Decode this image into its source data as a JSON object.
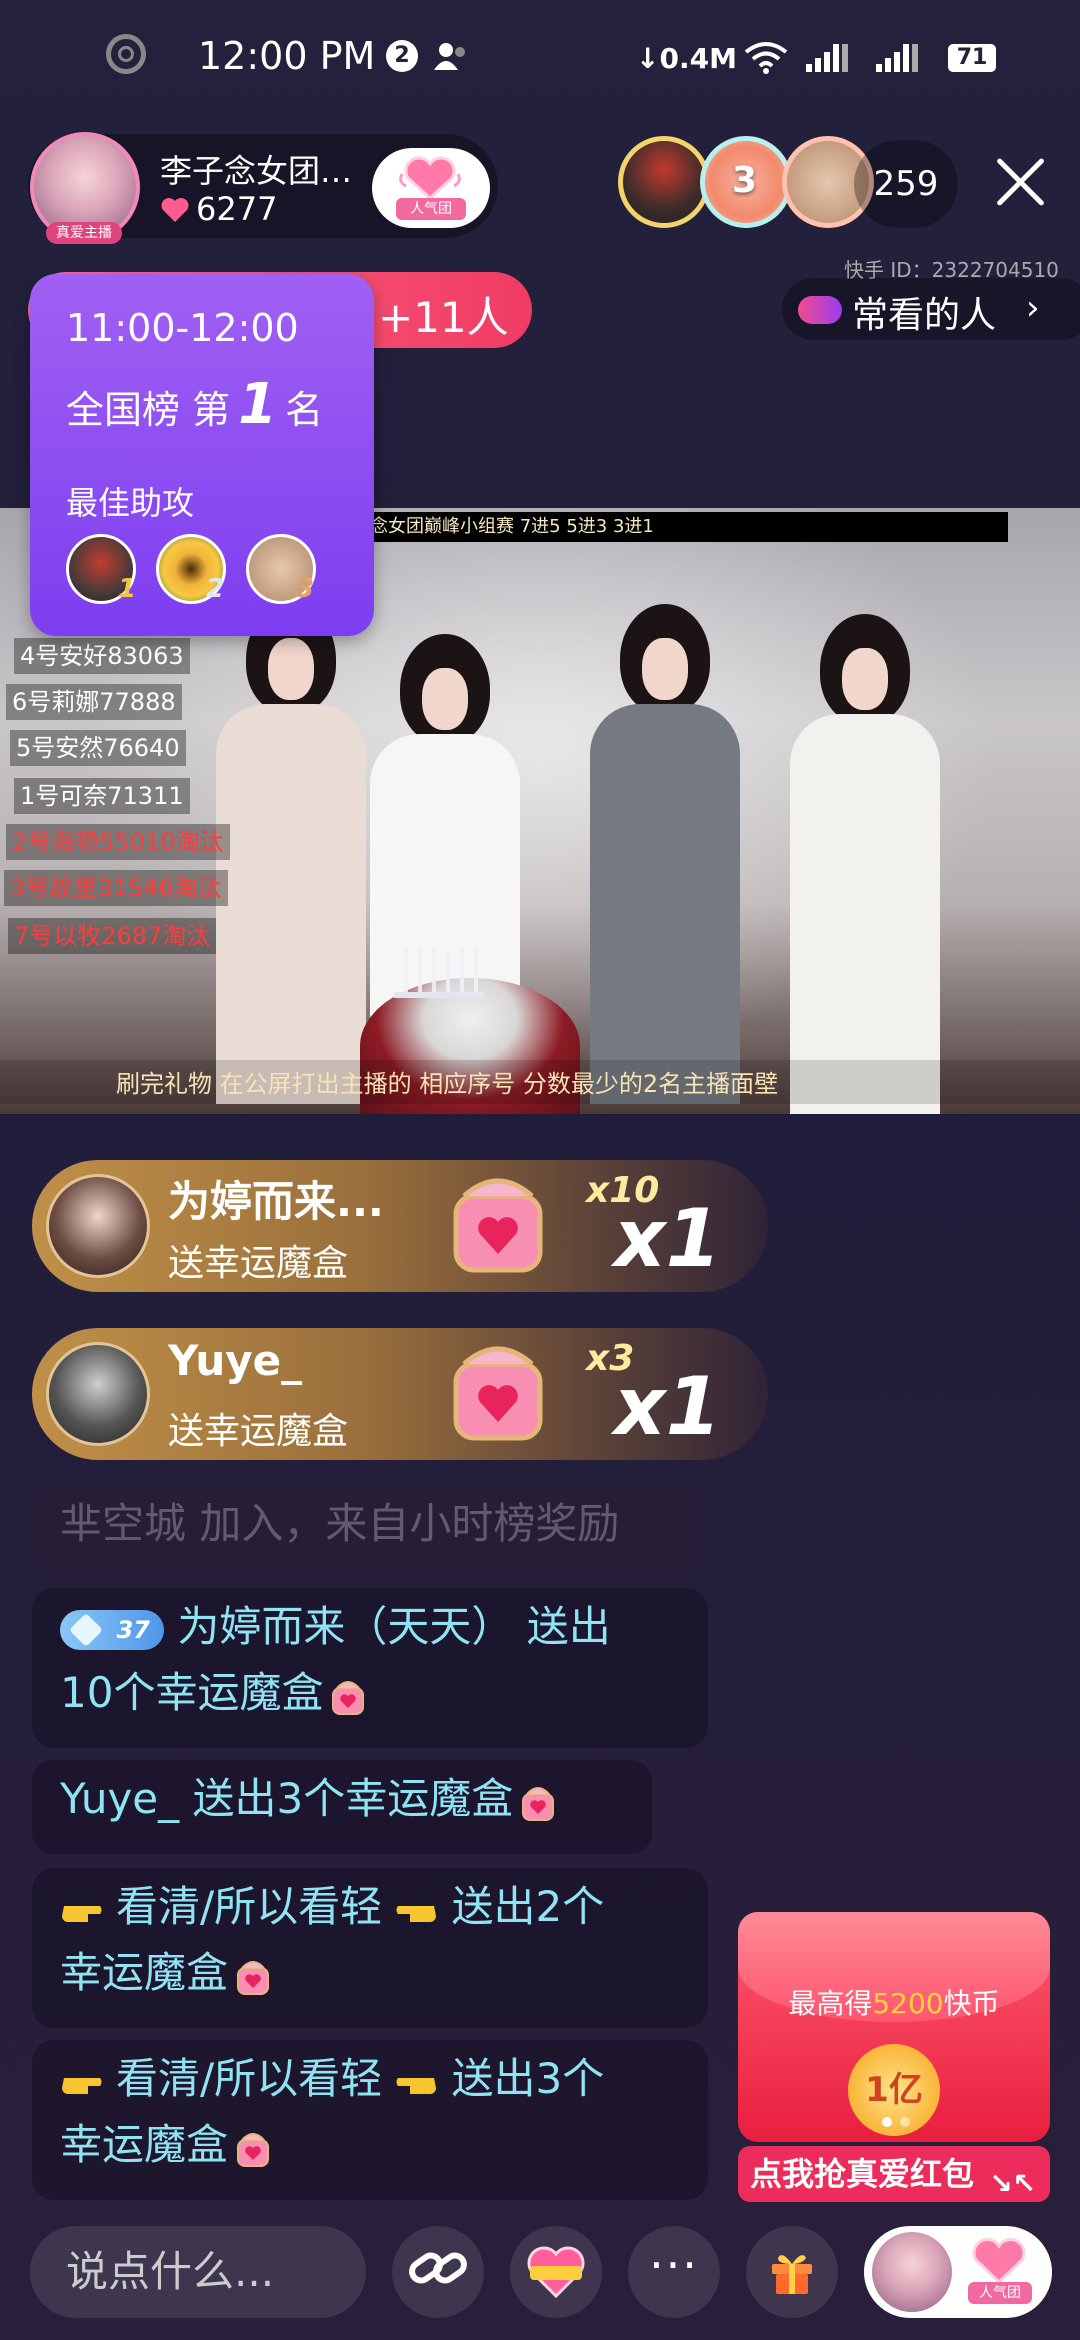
{
  "status_bar": {
    "time": "12:00 PM",
    "notification_count": "2",
    "network_speed": "0.4M",
    "battery": "71"
  },
  "host": {
    "name": "李子念女团…",
    "likes": "6277",
    "badge": "真爱主播",
    "fan_club_label": "人气团"
  },
  "viewers": {
    "count": "259",
    "second_viewer_number": "3",
    "kuaishou_id": "快手 ID：2322704510",
    "often_watched_label": "常看的人"
  },
  "promo_pill": {
    "text": "+11人"
  },
  "rank_card": {
    "time_range": "11:00-12:00",
    "rank_prefix": "全国榜 第",
    "rank_value": "1",
    "rank_suffix": "名",
    "assist_title": "最佳助攻",
    "assist_nums": [
      "1",
      "2",
      "3"
    ]
  },
  "stream": {
    "banner": "念女团巅峰小组赛 7进5 5进3 3进1",
    "scores": [
      {
        "text": "4号安好83063",
        "status": "ok"
      },
      {
        "text": "6号莉娜77888",
        "status": "ok"
      },
      {
        "text": "5号安然76640",
        "status": "ok"
      },
      {
        "text": "1号可奈71311",
        "status": "ok"
      },
      {
        "text": "2号海艳55010淘汰",
        "status": "out"
      },
      {
        "text": "3号故里31546淘汰",
        "status": "out"
      },
      {
        "text": "7号以牧2687淘汰",
        "status": "out"
      }
    ],
    "caption": "刷完礼物 在公屏打出主播的 相应序号 分数最少的2名主播面壁"
  },
  "gift_combos": [
    {
      "user": "为婷而来...",
      "action": "送幸运魔盒",
      "multiplier": "x10",
      "count": "x1"
    },
    {
      "user": "Yuye_",
      "action": "送幸运魔盒",
      "multiplier": "x3",
      "count": "x1"
    }
  ],
  "chat": {
    "faded_message": "芈空城 加入，来自小时榜奖励",
    "messages": [
      {
        "level": "37",
        "line1": "为婷而来（天天）   送出",
        "line2": "10个幸运魔盒"
      },
      {
        "line1": "Yuye_  送出3个幸运魔盒"
      },
      {
        "line1_user": "看清/所以看轻",
        "line1_rest": "  送出2个",
        "line2": "幸运魔盒"
      },
      {
        "line1_user": "看清/所以看轻",
        "line1_rest": "  送出3个",
        "line2": "幸运魔盒"
      }
    ]
  },
  "red_envelope": {
    "text_prefix": "最高得",
    "amount": "5200",
    "text_suffix": "快币",
    "coin_label": "1亿",
    "button": "点我抢真爱红包"
  },
  "bottom_bar": {
    "input_placeholder": "说点什么...",
    "more_label": "···",
    "fan_label": "人气团"
  }
}
